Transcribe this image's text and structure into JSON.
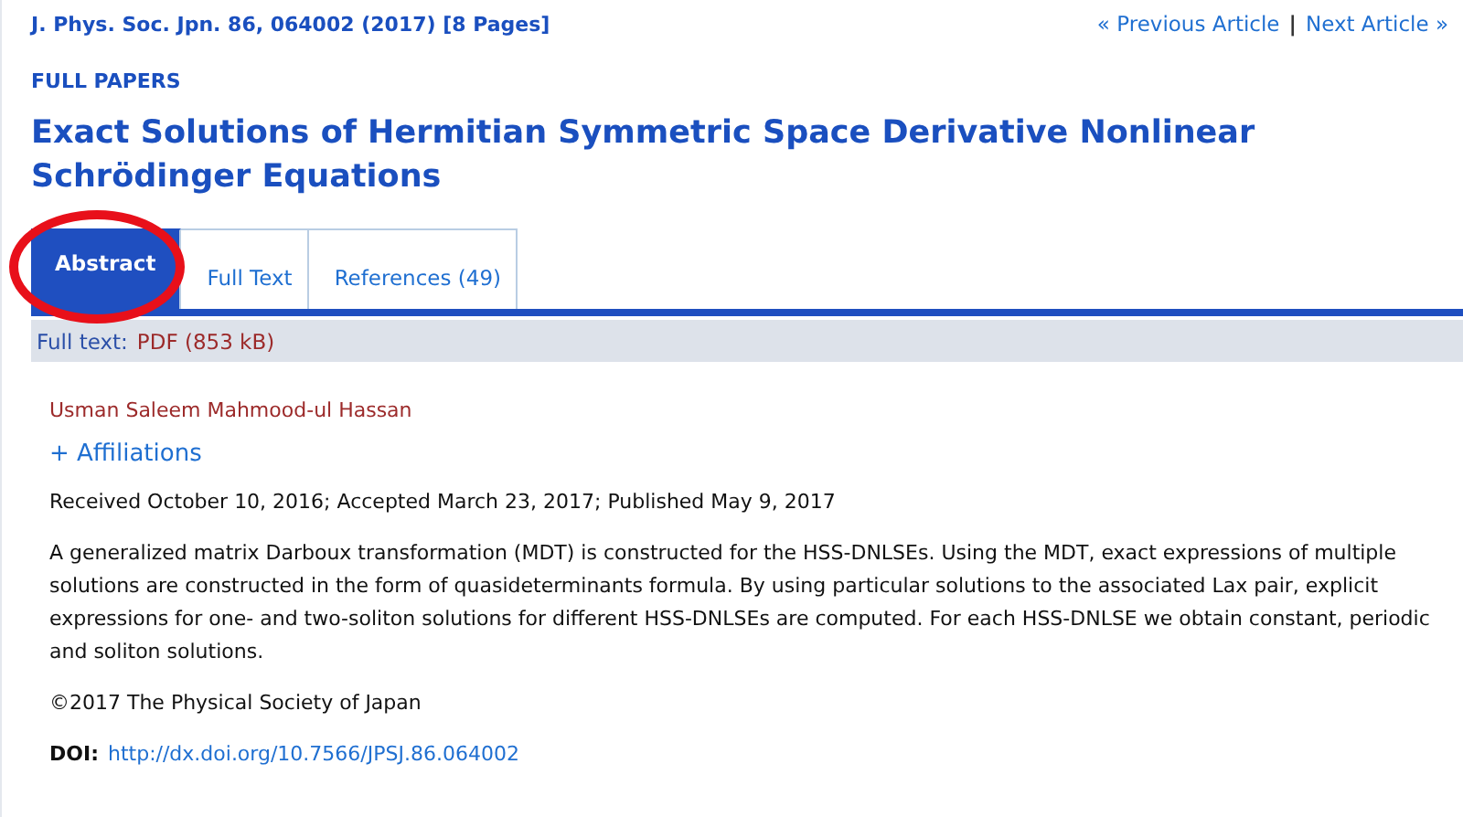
{
  "citation": "J. Phys. Soc. Jpn. 86, 064002 (2017) [8 Pages]",
  "nav": {
    "previous": "« Previous Article",
    "separator": "|",
    "next": "Next Article »"
  },
  "section": "FULL PAPERS",
  "title": "Exact Solutions of Hermitian Symmetric Space Derivative Nonlinear Schrödinger Equations",
  "tabs": [
    {
      "label": "Abstract",
      "selected": true,
      "circled": true
    },
    {
      "label": "Full Text",
      "selected": false,
      "circled": false
    },
    {
      "label": "References (49)",
      "selected": false,
      "circled": false
    }
  ],
  "fulltext_bar": {
    "label": "Full text:",
    "link": "PDF (853 kB)"
  },
  "author": "Usman Saleem Mahmood-ul Hassan",
  "affiliations": "+ Affiliations",
  "dates": "Received October 10, 2016; Accepted March 23, 2017; Published May 9, 2017",
  "abstract": "A generalized matrix Darboux transformation (MDT) is constructed for the HSS-DNLSEs. Using the MDT, exact expressions of multiple solutions are constructed in the form of quasideterminants formula. By using particular solutions to the associated Lax pair, explicit expressions for one- and two-soliton solutions for different HSS-DNLSEs are computed. For each HSS-DNLSE we obtain constant, periodic and soliton solutions.",
  "copyright": "©2017 The Physical Society of Japan",
  "doi": {
    "label": "DOI:",
    "link": "http://dx.doi.org/10.7566/JPSJ.86.064002"
  }
}
